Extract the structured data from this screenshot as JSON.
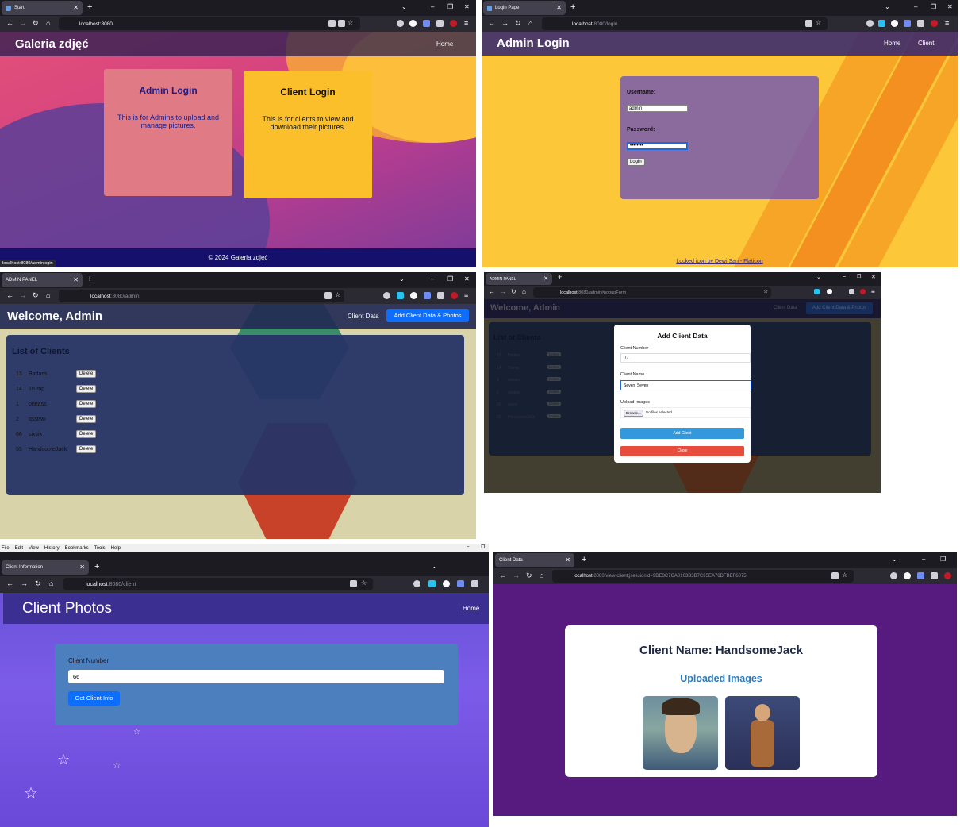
{
  "start": {
    "tab_title": "Start",
    "url": "localhost:8080",
    "brand": "Galeria zdjęć",
    "nav_home": "Home",
    "admin_card": {
      "title": "Admin Login",
      "desc": "This is for Admins to upload and manage pictures."
    },
    "client_card": {
      "title": "Client Login",
      "desc": "This is for clients to view and download their pictures."
    },
    "footer": "© 2024 Galeria zdjęć",
    "status_url": "localhost:8080/adminlogin"
  },
  "login": {
    "tab_title": "Login Page",
    "url_host": "localhost",
    "url_path": ":8080/login",
    "brand": "Admin Login",
    "nav": [
      "Home",
      "Client"
    ],
    "username_label": "Username:",
    "username_value": "admin",
    "password_label": "Password:",
    "password_value": "••••••••",
    "login_button": "Login",
    "footer_credit": "Locked icon by Dewi Sari - Flaticon"
  },
  "admin": {
    "tab_title": "ADMIN PANEL",
    "url_host": "localhost",
    "url_path": ":8080/admin",
    "welcome": "Welcome, Admin",
    "nav_client_data": "Client Data",
    "nav_add": "Add Client Data & Photos",
    "list_title": "List of Clients",
    "delete_label": "Delete",
    "clients": [
      {
        "id": "13",
        "name": "Badass"
      },
      {
        "id": "14",
        "name": "Trump"
      },
      {
        "id": "1",
        "name": "oneass"
      },
      {
        "id": "2",
        "name": "qsstwo"
      },
      {
        "id": "66",
        "name": "sixsix"
      },
      {
        "id": "55",
        "name": "HandsomeJack"
      }
    ]
  },
  "popup": {
    "tab_title": "ADMIN PANEL",
    "url_host": "localhost",
    "url_path": ":8080/admin#popupForm",
    "welcome": "Welcome, Admin",
    "nav_client_data": "Client Data",
    "nav_add": "Add Client Data & Photos",
    "list_title": "List of Clients",
    "modal_title": "Add Client Data",
    "client_number_label": "Client Number",
    "client_number_value": "77",
    "client_name_label": "Client Name",
    "client_name_value": "Seven_Seven",
    "upload_label": "Upload Images",
    "browse_button": "Browse...",
    "no_files": "No files selected.",
    "add_button": "Add Client",
    "close_button": "Close",
    "bg_clients": [
      {
        "id": "13",
        "name": "Badass"
      },
      {
        "id": "14",
        "name": "Trump"
      },
      {
        "id": "1",
        "name": "oneass"
      },
      {
        "id": "2",
        "name": "qsstwo"
      },
      {
        "id": "66",
        "name": "sixsix"
      },
      {
        "id": "55",
        "name": "HandsomeJack"
      }
    ]
  },
  "client": {
    "menu": [
      "File",
      "Edit",
      "View",
      "History",
      "Bookmarks",
      "Tools",
      "Help"
    ],
    "tab_title": "Client Information",
    "url_host": "localhost",
    "url_path": ":8080/client",
    "title": "Client Photos",
    "nav_home": "Home",
    "field_label": "Client Number",
    "field_value": "66",
    "button": "Get Client Info"
  },
  "clientdata": {
    "tab_title": "Client Data",
    "url_host": "localhost",
    "url_path": ":8080/view-client;jsessionid=9DE3C7CA0103B3B7C95EA76DFBEF6075",
    "name_heading": "Client Name: HandsomeJack",
    "uploaded_heading": "Uploaded Images"
  },
  "colors": {
    "browser_tabbar": "#1c1b22",
    "browser_nav": "#2b2a33",
    "primary_blue": "#0d6efd",
    "add_blue": "#3498db",
    "close_red": "#e74c3c",
    "purple_bg": "#571b7f"
  }
}
